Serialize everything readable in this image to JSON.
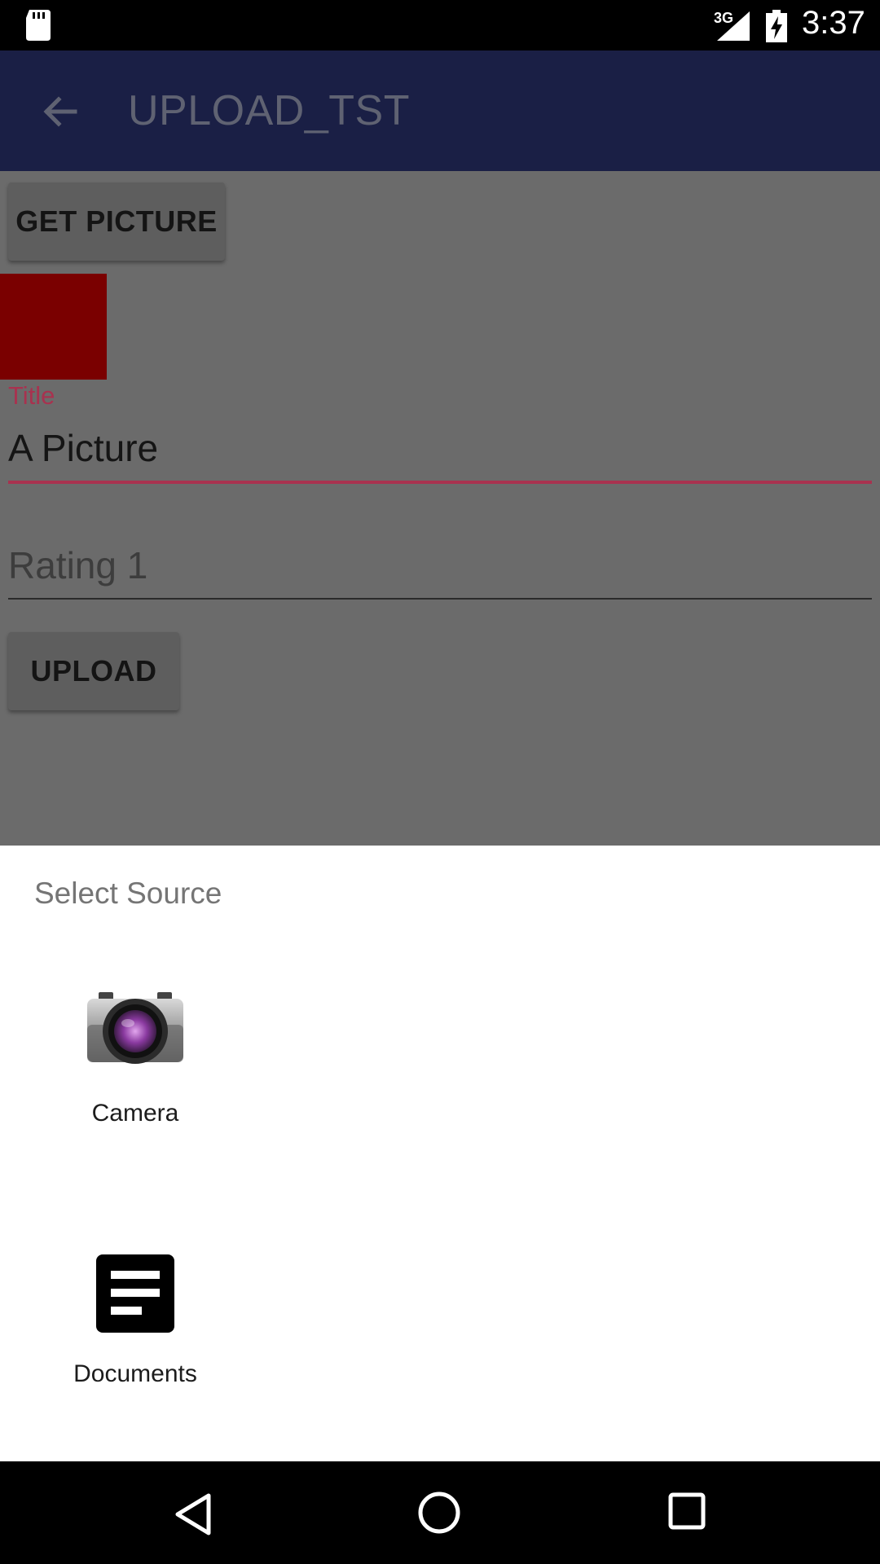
{
  "status_bar": {
    "network": "3G",
    "time": "3:37"
  },
  "app_bar": {
    "title": "UPLOAD_TST"
  },
  "form": {
    "get_picture_label": "GET PICTURE",
    "title_label": "Title",
    "title_value": "A Picture",
    "rating_placeholder": "Rating 1",
    "upload_label": "UPLOAD"
  },
  "sheet": {
    "title": "Select Source",
    "options": [
      {
        "label": "Camera",
        "icon": "camera-icon"
      },
      {
        "label": "Documents",
        "icon": "documents-icon"
      }
    ]
  },
  "colors": {
    "app_bar": "#1a1f45",
    "accent": "#a8324f",
    "picture_preview": "#7a0000",
    "scrim": "#6b6b6b"
  }
}
